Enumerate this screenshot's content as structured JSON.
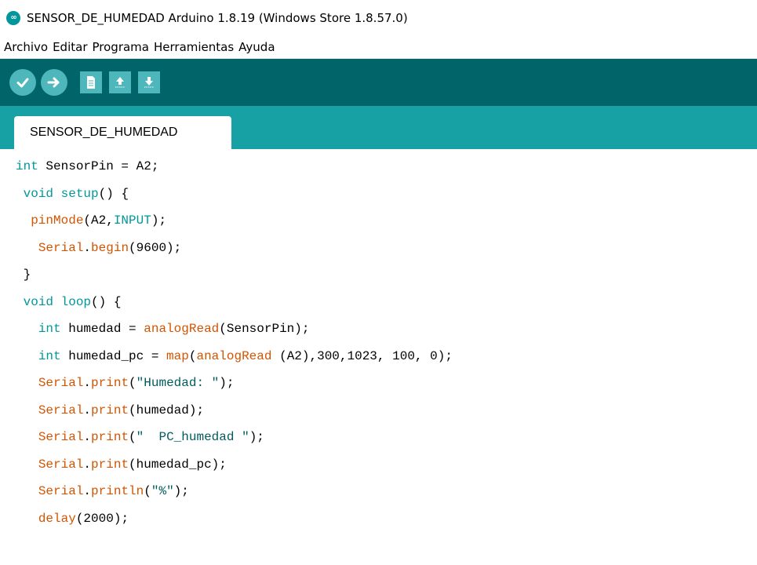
{
  "window": {
    "title": "SENSOR_DE_HUMEDAD Arduino 1.8.19 (Windows Store 1.8.57.0)"
  },
  "menu": {
    "items": [
      "Archivo",
      "Editar",
      "Programa",
      "Herramientas",
      "Ayuda"
    ]
  },
  "toolbar": {
    "buttons": [
      "verify-icon",
      "upload-icon",
      "new-file-icon",
      "open-icon",
      "save-icon"
    ]
  },
  "tabs": [
    {
      "label": "SENSOR_DE_HUMEDAD",
      "active": true
    }
  ],
  "colors": {
    "toolbar_bg": "#006468",
    "tabstrip_bg": "#17a1a5",
    "button_bg": "#4db7bb",
    "keyword": "#00979c",
    "function": "#d35400"
  },
  "code": {
    "lines": [
      [
        {
          "t": "int",
          "c": "kw"
        },
        {
          "t": " SensorPin = A2;",
          "c": ""
        }
      ],
      [
        {
          "t": " ",
          "c": ""
        },
        {
          "t": "void",
          "c": "kw"
        },
        {
          "t": " ",
          "c": ""
        },
        {
          "t": "setup",
          "c": "kw"
        },
        {
          "t": "() {",
          "c": ""
        }
      ],
      [
        {
          "t": "  ",
          "c": ""
        },
        {
          "t": "pinMode",
          "c": "fn"
        },
        {
          "t": "(A2,",
          "c": ""
        },
        {
          "t": "INPUT",
          "c": "kw"
        },
        {
          "t": ");",
          "c": ""
        }
      ],
      [
        {
          "t": "   ",
          "c": ""
        },
        {
          "t": "Serial",
          "c": "fn"
        },
        {
          "t": ".",
          "c": ""
        },
        {
          "t": "begin",
          "c": "fn"
        },
        {
          "t": "(9600);",
          "c": ""
        }
      ],
      [
        {
          "t": " }",
          "c": ""
        }
      ],
      [
        {
          "t": " ",
          "c": ""
        },
        {
          "t": "void",
          "c": "kw"
        },
        {
          "t": " ",
          "c": ""
        },
        {
          "t": "loop",
          "c": "kw"
        },
        {
          "t": "() {",
          "c": ""
        }
      ],
      [
        {
          "t": "   ",
          "c": ""
        },
        {
          "t": "int",
          "c": "kw"
        },
        {
          "t": " humedad = ",
          "c": ""
        },
        {
          "t": "analogRead",
          "c": "fn"
        },
        {
          "t": "(SensorPin);",
          "c": ""
        }
      ],
      [
        {
          "t": "   ",
          "c": ""
        },
        {
          "t": "int",
          "c": "kw"
        },
        {
          "t": " humedad_pc = ",
          "c": ""
        },
        {
          "t": "map",
          "c": "fn"
        },
        {
          "t": "(",
          "c": ""
        },
        {
          "t": "analogRead",
          "c": "fn"
        },
        {
          "t": " (A2),300,1023, 100, 0);",
          "c": ""
        }
      ],
      [
        {
          "t": "   ",
          "c": ""
        },
        {
          "t": "Serial",
          "c": "fn"
        },
        {
          "t": ".",
          "c": ""
        },
        {
          "t": "print",
          "c": "fn"
        },
        {
          "t": "(",
          "c": ""
        },
        {
          "t": "\"Humedad: \"",
          "c": "str"
        },
        {
          "t": ");",
          "c": ""
        }
      ],
      [
        {
          "t": "   ",
          "c": ""
        },
        {
          "t": "Serial",
          "c": "fn"
        },
        {
          "t": ".",
          "c": ""
        },
        {
          "t": "print",
          "c": "fn"
        },
        {
          "t": "(humedad);",
          "c": ""
        }
      ],
      [
        {
          "t": "   ",
          "c": ""
        },
        {
          "t": "Serial",
          "c": "fn"
        },
        {
          "t": ".",
          "c": ""
        },
        {
          "t": "print",
          "c": "fn"
        },
        {
          "t": "(",
          "c": ""
        },
        {
          "t": "\"  PC_humedad \"",
          "c": "str"
        },
        {
          "t": ");",
          "c": ""
        }
      ],
      [
        {
          "t": "   ",
          "c": ""
        },
        {
          "t": "Serial",
          "c": "fn"
        },
        {
          "t": ".",
          "c": ""
        },
        {
          "t": "print",
          "c": "fn"
        },
        {
          "t": "(humedad_pc);",
          "c": ""
        }
      ],
      [
        {
          "t": "   ",
          "c": ""
        },
        {
          "t": "Serial",
          "c": "fn"
        },
        {
          "t": ".",
          "c": ""
        },
        {
          "t": "println",
          "c": "fn"
        },
        {
          "t": "(",
          "c": ""
        },
        {
          "t": "\"%\"",
          "c": "str"
        },
        {
          "t": ");",
          "c": ""
        }
      ],
      [
        {
          "t": "   ",
          "c": ""
        },
        {
          "t": "delay",
          "c": "fn"
        },
        {
          "t": "(2000);",
          "c": ""
        }
      ],
      [],
      [
        {
          "t": "  }",
          "c": ""
        }
      ]
    ]
  }
}
